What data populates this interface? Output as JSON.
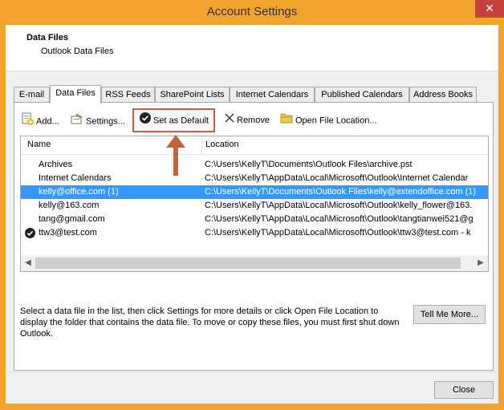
{
  "window": {
    "title": "Account Settings",
    "close_glyph": "✕"
  },
  "header": {
    "title": "Data Files",
    "subtitle": "Outlook Data Files"
  },
  "tabs": [
    {
      "label": "E-mail",
      "active": false
    },
    {
      "label": "Data Files",
      "active": true
    },
    {
      "label": "RSS Feeds",
      "active": false
    },
    {
      "label": "SharePoint Lists",
      "active": false
    },
    {
      "label": "Internet Calendars",
      "active": false
    },
    {
      "label": "Published Calendars",
      "active": false
    },
    {
      "label": "Address Books",
      "active": false
    }
  ],
  "toolbar": {
    "add": "Add...",
    "settings": "Settings...",
    "set_default": "Set as Default",
    "remove": "Remove",
    "open_location": "Open File Location..."
  },
  "list": {
    "columns": [
      "Name",
      "Location"
    ],
    "rows": [
      {
        "name": "Archives",
        "location": "C:\\Users\\KellyT\\Documents\\Outlook Files\\archive.pst",
        "selected": false,
        "default": false
      },
      {
        "name": "Internet Calendars",
        "location": "C:\\Users\\KellyT\\AppData\\Local\\Microsoft\\Outlook\\Internet Calendar",
        "selected": false,
        "default": false
      },
      {
        "name": "kelly@office.com (1)",
        "location": "C:\\Users\\KellyT\\Documents\\Outlook Files\\kelly@extendoffice.com (1)",
        "selected": true,
        "default": false
      },
      {
        "name": "kelly@163.com",
        "location": "C:\\Users\\KellyT\\AppData\\Local\\Microsoft\\Outlook\\kelly_flower@163.",
        "selected": false,
        "default": false
      },
      {
        "name": "tang@gmail.com",
        "location": "C:\\Users\\KellyT\\AppData\\Local\\Microsoft\\Outlook\\tangtianwei521@g",
        "selected": false,
        "default": false
      },
      {
        "name": "ttw3@test.com",
        "location": "C:\\Users\\KellyT\\AppData\\Local\\Microsoft\\Outlook\\ttw3@test.com - k",
        "selected": false,
        "default": true
      }
    ]
  },
  "description": "Select a data file in the list, then click Settings for more details or click Open File Location to display the folder that contains the data file. To move or copy these files, you must first shut down Outlook.",
  "tell_me_more": "Tell Me More...",
  "close_button": "Close",
  "colors": {
    "title_bar": "#f0a32d",
    "selection": "#3399ff",
    "highlight_border": "#c0633e",
    "close_red": "#c7403a"
  }
}
